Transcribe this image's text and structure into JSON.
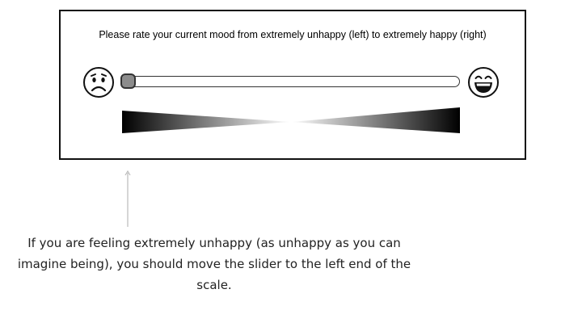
{
  "prompt_text": "Please rate your current mood from extremely unhappy (left) to extremely happy (right)",
  "scale": {
    "left_icon": "sad-face-icon",
    "right_icon": "happy-face-icon",
    "slider_value": 0.0
  },
  "instruction_text": "If you are feeling extremely unhappy (as unhappy as you can imagine being), you should move the slider to the left end of the scale.",
  "colors": {
    "border": "#111111",
    "thumb": "#8c8c8c",
    "arrow": "#bbbbbb"
  }
}
